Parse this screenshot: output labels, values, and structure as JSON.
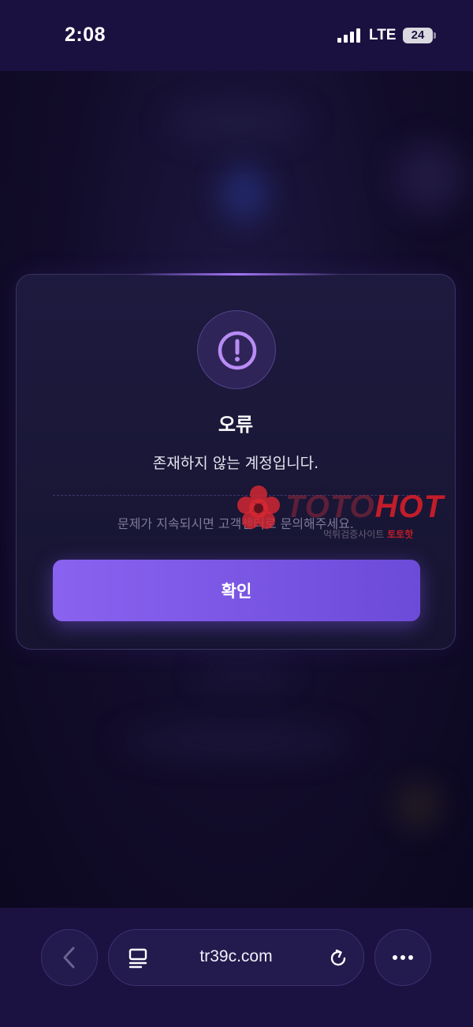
{
  "status_bar": {
    "time": "2:08",
    "network": "LTE",
    "battery": "24"
  },
  "modal": {
    "icon": "exclamation-circle-icon",
    "title": "오류",
    "message": "존재하지 않는 계정입니다.",
    "hint": "문제가 지속되시면 고객센터로 문의해주세요.",
    "confirm_label": "확인",
    "accent_color": "#7b57e6"
  },
  "watermark": {
    "brand_part1": "TOTO",
    "brand_part2": "HOT",
    "sub_text": "먹튀검증사이트",
    "sub_text_red": "토토핫"
  },
  "browser": {
    "url": "tr39c.com",
    "back_icon": "chevron-left-icon",
    "tabs_icon": "tabs-icon",
    "reload_icon": "reload-icon",
    "more_icon": "more-dots-icon"
  }
}
